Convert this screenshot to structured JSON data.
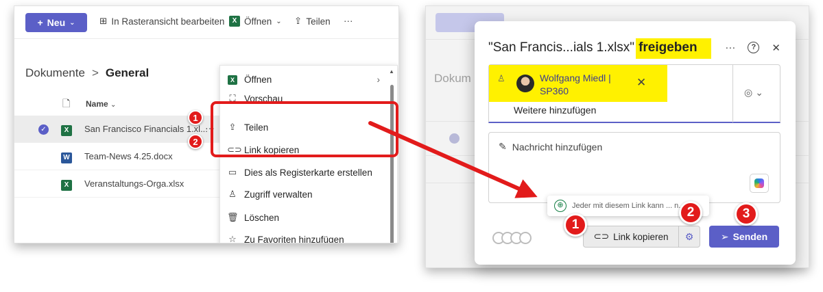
{
  "library": {
    "toolbar": {
      "new_label": "Neu",
      "grid_label": "In Rasteransicht bearbeiten",
      "open_label": "Öffnen",
      "share_label": "Teilen",
      "more": "···"
    },
    "breadcrumb": {
      "root": "Dokumente",
      "separator": ">",
      "current": "General"
    },
    "column_name": "Name",
    "files": [
      {
        "name": "San Francisco Financials 1.xl...",
        "type": "xlsx",
        "more": "···"
      },
      {
        "name": "Team-News 4.25.docx",
        "type": "docx"
      },
      {
        "name": "Veranstaltungs-Orga.xlsx",
        "type": "xlsx"
      }
    ],
    "context_menu": [
      {
        "label": "Öffnen",
        "icon": "excel-icon"
      },
      {
        "label": "Vorschau",
        "icon": "preview-icon"
      },
      {
        "label": "Teilen",
        "icon": "share-icon"
      },
      {
        "label": "Link kopieren",
        "icon": "link-icon"
      },
      {
        "label": "Dies als Registerkarte erstellen",
        "icon": "tab-icon"
      },
      {
        "label": "Zugriff verwalten",
        "icon": "person-icon"
      },
      {
        "label": "Löschen",
        "icon": "trash-icon"
      },
      {
        "label": "Zu Favoriten hinzufügen",
        "icon": "star-icon"
      }
    ],
    "badges": [
      "1",
      "2"
    ]
  },
  "share_dialog": {
    "background_label": "Dokum",
    "title_prefix": "\"San Francis...ials 1.xlsx\"",
    "title_action": "freigeben",
    "more": "···",
    "help": "?",
    "close": "✕",
    "person": {
      "name": "Wolfgang Miedl | SP360"
    },
    "add_more": "Weitere hinzufügen",
    "message_placeholder": "Nachricht hinzufügen",
    "tooltip": "Jeder mit diesem Link kann ... n.",
    "copy_link": "Link kopieren",
    "send": "Senden",
    "badges": [
      "1",
      "2",
      "3"
    ]
  },
  "colors": {
    "accent": "#5b5fc7",
    "highlight_red": "#e21b1b",
    "highlight_yellow": "#fff100",
    "excel_green": "#1f7244",
    "word_blue": "#2b579a"
  }
}
